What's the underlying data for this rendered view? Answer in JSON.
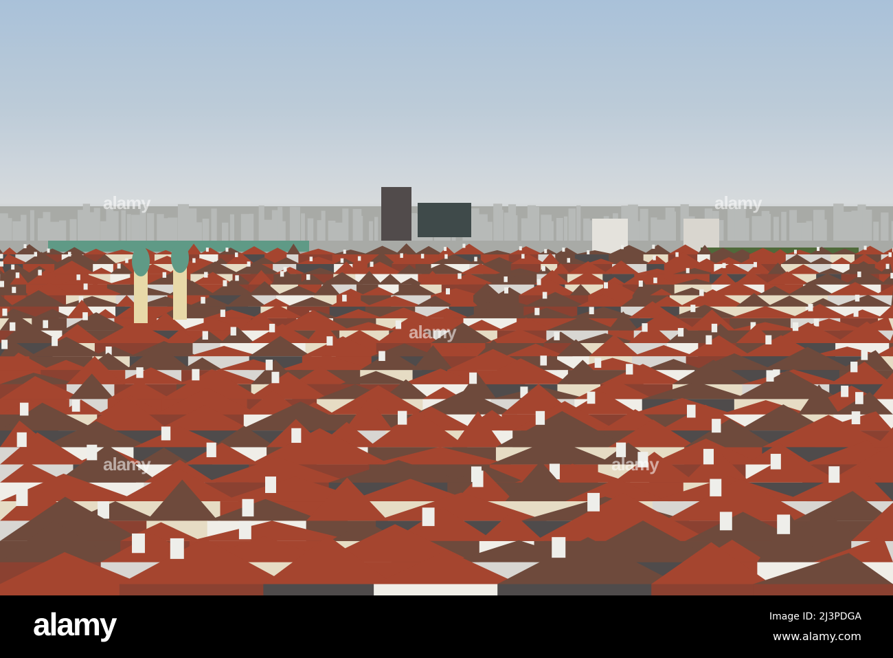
{
  "watermark": {
    "text": "alamy"
  },
  "footer": {
    "logo": "alamy",
    "image_id": "Image ID: 2J3PDGA",
    "website": "www.alamy.com"
  },
  "colors": {
    "roof_red": "#a5452f",
    "roof_brown": "#6e4a3c",
    "roof_grey": "#4f4b4b",
    "wall_cream": "#e6dcc4",
    "copper_green": "#5f9a86"
  }
}
